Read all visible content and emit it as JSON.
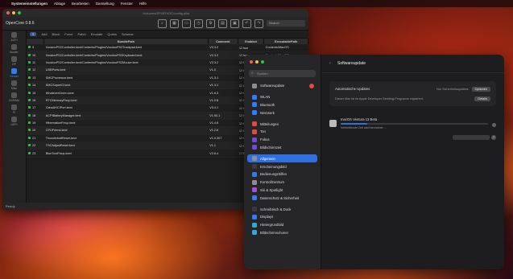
{
  "menubar": {
    "app": "Systemeinstellungen",
    "items": [
      "Ablage",
      "Bearbeiten",
      "Darstellung",
      "Fenster",
      "Hilfe"
    ]
  },
  "opencore": {
    "title": "/Volumes/EFI/EFI/OC/config.plist",
    "version": "OpenCore 0.8.6",
    "search_placeholder": "Search",
    "sidebar": [
      {
        "label": "ACPI",
        "active": false
      },
      {
        "label": "Booter",
        "active": false
      },
      {
        "label": "DP",
        "active": false
      },
      {
        "label": "Kernel",
        "active": true
      },
      {
        "label": "Misc",
        "active": false
      },
      {
        "label": "NVRAM",
        "active": false
      },
      {
        "label": "PI",
        "active": false
      },
      {
        "label": "UEFI",
        "active": false
      }
    ],
    "tabs": [
      "Add",
      "Block",
      "Force",
      "Patch",
      "Emulate",
      "Quirks",
      "Scheme"
    ],
    "columns": [
      "",
      "BundlePath",
      "Comment",
      "Enabled",
      "ExecutablePath"
    ],
    "rows": [
      {
        "n": "9",
        "path": "VoodooPS2Controller.kext/Contents/PlugIns/VoodooPS2Trackpad.kext",
        "comment": "V2.3.2",
        "enabled": "true"
      },
      {
        "n": "10",
        "path": "VoodooPS2Controller.kext/Contents/PlugIns/VoodooPS2Keyboard.kext",
        "comment": "V2.3.2",
        "enabled": "true"
      },
      {
        "n": "11",
        "path": "VoodooPS2Controller.kext/Contents/PlugIns/VoodooPS2Mouse.kext",
        "comment": "V2.3.2",
        "enabled": "true"
      },
      {
        "n": "12",
        "path": "USBPorts.kext",
        "comment": "V1.0",
        "enabled": "true"
      },
      {
        "n": "13",
        "path": "SMCProcessor.kext",
        "comment": "V1.3.1",
        "enabled": "true"
      },
      {
        "n": "14",
        "path": "SMCSuperIO.kext",
        "comment": "V1.3.1",
        "enabled": "true"
      },
      {
        "n": "15",
        "path": "WhateverGreen.kext",
        "comment": "V1.6.3",
        "enabled": "true"
      },
      {
        "n": "16",
        "path": "RTCMemoryFixup.kext",
        "comment": "V1.0.8",
        "enabled": "true"
      },
      {
        "n": "17",
        "path": "CtlnaAHCIPort.kext",
        "comment": "V3.4.1",
        "enabled": "true"
      },
      {
        "n": "18",
        "path": "ACPIBatteryManager.kext",
        "comment": "V1.90.1",
        "enabled": "true"
      },
      {
        "n": "19",
        "path": "HibernationFixup.kext",
        "comment": "V1.4.8",
        "enabled": "true"
      },
      {
        "n": "20",
        "path": "CPUFriend.kext",
        "comment": "V1.2.6",
        "enabled": "true"
      },
      {
        "n": "21",
        "path": "ThunderboltReset.kext",
        "comment": "V1.0.307",
        "enabled": "true"
      },
      {
        "n": "22",
        "path": "TSCAdjustReset.kext",
        "comment": "V1.1",
        "enabled": "true"
      },
      {
        "n": "23",
        "path": "BlueToolFixup.kext",
        "comment": "V2.6.4",
        "enabled": "false"
      }
    ],
    "status": "Ready"
  },
  "settings": {
    "search_placeholder": "Suchen",
    "sidebar": [
      {
        "label": "Softwareupdate",
        "color": "#8e8e93",
        "active": false,
        "badge": true
      },
      {
        "gap": true
      },
      {
        "label": "WLAN",
        "color": "#2f7cf6",
        "active": false
      },
      {
        "label": "Bluetooth",
        "color": "#2f7cf6",
        "active": false
      },
      {
        "label": "Netzwerk",
        "color": "#2f7cf6",
        "active": false
      },
      {
        "gap": true
      },
      {
        "label": "Mitteilungen",
        "color": "#e5483c",
        "active": false
      },
      {
        "label": "Ton",
        "color": "#e5483c",
        "active": false
      },
      {
        "label": "Fokus",
        "color": "#6e4bd8",
        "active": false
      },
      {
        "label": "Bildschirmzeit",
        "color": "#6e4bd8",
        "active": false
      },
      {
        "gap": true
      },
      {
        "label": "Allgemein",
        "color": "#8e8e93",
        "active": true
      },
      {
        "label": "Erscheinungsbild",
        "color": "#3a3a3c",
        "active": false
      },
      {
        "label": "Bedienungshilfen",
        "color": "#2f7cf6",
        "active": false
      },
      {
        "label": "Kontrollzentrum",
        "color": "#8e8e93",
        "active": false
      },
      {
        "label": "Siri & Spotlight",
        "color": "#a74bd8",
        "active": false
      },
      {
        "label": "Datenschutz & Sicherheit",
        "color": "#2f7cf6",
        "active": false
      },
      {
        "gap": true
      },
      {
        "label": "Schreibtisch & Dock",
        "color": "#3a3a3c",
        "active": false
      },
      {
        "label": "Displays",
        "color": "#2f7cf6",
        "active": false
      },
      {
        "label": "Hintergrundbild",
        "color": "#32a8d8",
        "active": false
      },
      {
        "label": "Bildschirmschoner",
        "color": "#32a8d8",
        "active": false
      }
    ],
    "header": {
      "back": "‹",
      "title": "Softwareupdate"
    },
    "auto_updates": {
      "label": "Automatische Updates",
      "value": "Nur Sicherheitsupdates",
      "button": "Optionen"
    },
    "beta": {
      "label": "Beta-Updates",
      "sub": "Dieser Mac ist im Apple Developer Seeding-Programm registriert.",
      "button": "Details"
    },
    "update": {
      "name": "macOS Ventura 13 Beta",
      "progress": 0.18,
      "sub": "Verbleibende Zeit wird berechnet …"
    },
    "help": "?"
  }
}
